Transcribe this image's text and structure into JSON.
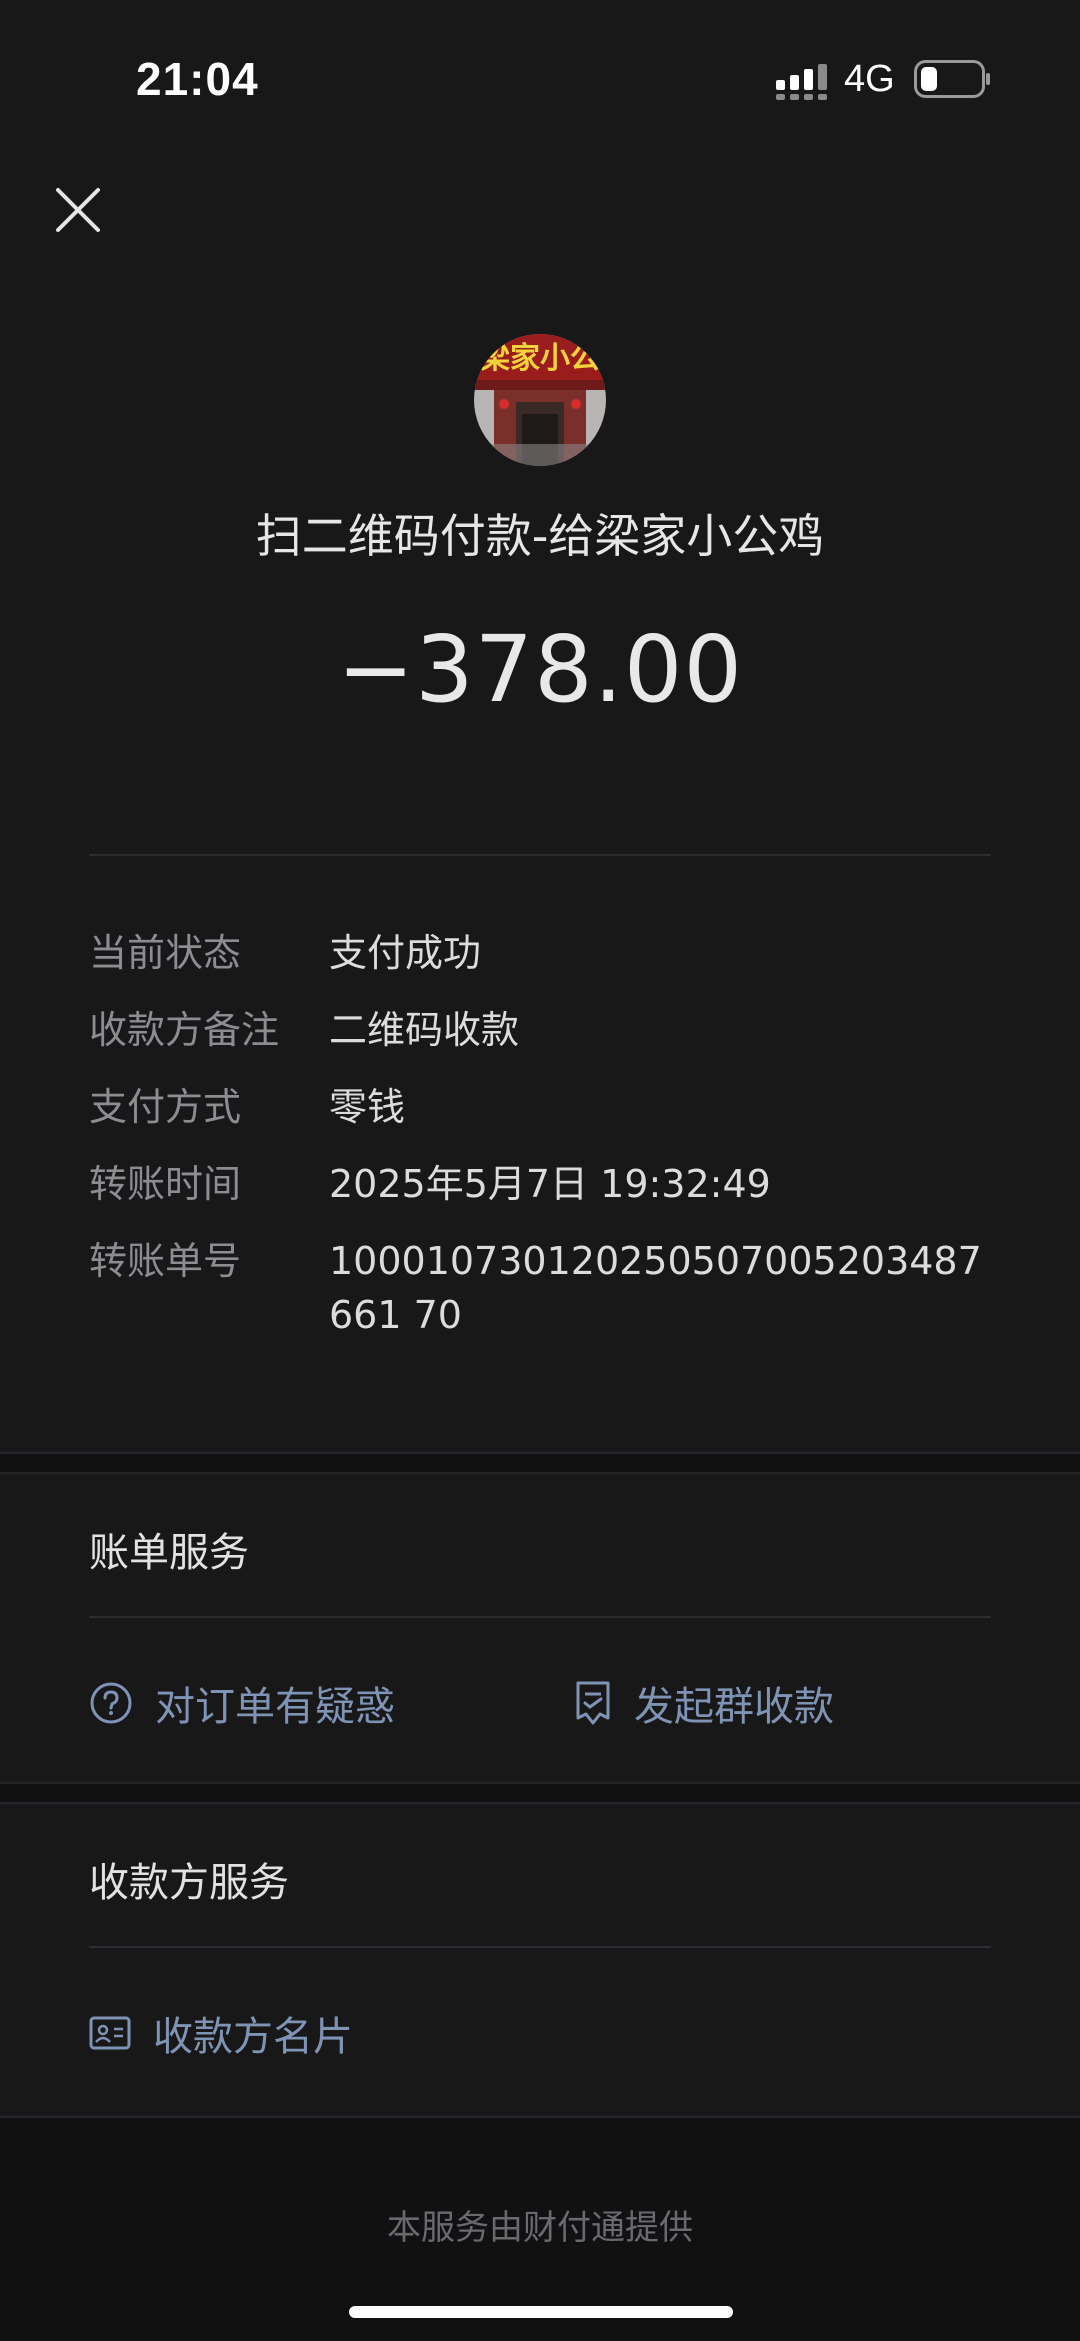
{
  "status_bar": {
    "time": "21:04",
    "network": "4G"
  },
  "header": {
    "close_icon": "close-icon"
  },
  "merchant": {
    "avatar_text": "梁家小公",
    "title": "扫二维码付款-给梁家小公鸡",
    "amount": "−378.00"
  },
  "details": [
    {
      "label": "当前状态",
      "value": "支付成功"
    },
    {
      "label": "收款方备注",
      "value": "二维码收款"
    },
    {
      "label": "支付方式",
      "value": "零钱"
    },
    {
      "label": "转账时间",
      "value": "2025年5月7日 19:32:49"
    },
    {
      "label": "转账单号",
      "value": "100010730120250507005203487661 70"
    }
  ],
  "bill_service": {
    "title": "账单服务",
    "question_label": "对订单有疑惑",
    "group_collect_label": "发起群收款"
  },
  "payee_service": {
    "title": "收款方服务",
    "card_label": "收款方名片"
  },
  "footer": {
    "text": "本服务由财付通提供"
  },
  "colors": {
    "background": "#181819",
    "link": "#7f94b5",
    "label": "#8d8d90"
  }
}
